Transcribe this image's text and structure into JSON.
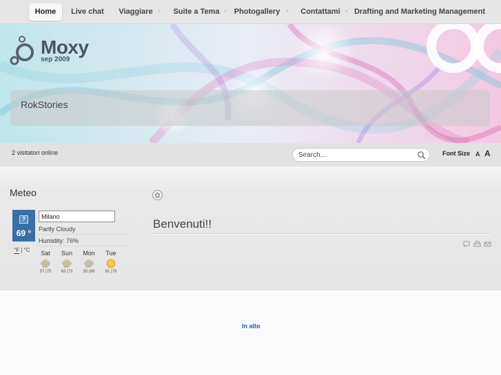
{
  "nav": {
    "items": [
      {
        "label": "Home",
        "active": true
      },
      {
        "label": "Live chat"
      },
      {
        "label": "Viaggiare"
      },
      {
        "label": "Suite a Tema"
      },
      {
        "label": "Photogallery"
      },
      {
        "label": "Contattami"
      },
      {
        "label": "Drafting and Marketing Management"
      }
    ]
  },
  "header": {
    "logo_text": "Moxy",
    "logo_sub": "sep 2009",
    "stories_title": "RokStories"
  },
  "utility": {
    "visitors": "2 visitatori online",
    "search_placeholder": "Search...",
    "font_size_label": "Font Size",
    "font_small": "A",
    "font_large": "A",
    "icons": {
      "search": "magnifier-icon"
    }
  },
  "meteo": {
    "title": "Meteo",
    "current_icon_glyph": "?",
    "temperature": "69 °",
    "city": "Milano",
    "condition": "Partly Cloudy",
    "humidity": "Humidity: 76%",
    "unit_f": "°F",
    "unit_sep": "|",
    "unit_c": "°C",
    "forecast": [
      {
        "day": "Sat",
        "temps": "57 |75",
        "icon": "cloud-rain-icon"
      },
      {
        "day": "Sun",
        "temps": "63 |73",
        "icon": "cloud-rain-icon"
      },
      {
        "day": "Mon",
        "temps": "55 |66",
        "icon": "cloud-rain-icon"
      },
      {
        "day": "Tue",
        "temps": "61 |79",
        "icon": "sun-icon"
      }
    ]
  },
  "content": {
    "title": "Benvenuti!!"
  },
  "footer": {
    "top_link": "In alto"
  },
  "colors": {
    "nav_bg": "#e6e6e6",
    "weather_box": "#3a6fa5",
    "link": "#1d5fa0"
  }
}
